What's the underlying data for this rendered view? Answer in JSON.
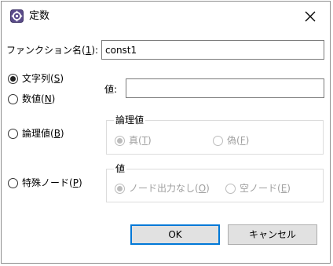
{
  "window": {
    "title": "定数",
    "icon": "constant-gear-icon",
    "close_icon": "close-icon"
  },
  "function_name": {
    "label_prefix": "ファンクション名(",
    "label_mnemonic": "1",
    "label_suffix": "):",
    "value": "const1"
  },
  "type_options": {
    "string": {
      "prefix": "文字列(",
      "mnemonic": "S",
      "suffix": ")",
      "selected": true
    },
    "number": {
      "prefix": "数値(",
      "mnemonic": "N",
      "suffix": ")",
      "selected": false
    },
    "boolean": {
      "prefix": "論理値(",
      "mnemonic": "B",
      "suffix": ")",
      "selected": false
    },
    "special_node": {
      "prefix": "特殊ノード(",
      "mnemonic": "P",
      "suffix": ")",
      "selected": false
    }
  },
  "value_field": {
    "label": "値:",
    "value": ""
  },
  "boolean_group": {
    "title": "論理値",
    "true_option": {
      "prefix": "真(",
      "mnemonic": "T",
      "suffix": ")",
      "selected": true
    },
    "false_option": {
      "prefix": "偽(",
      "mnemonic": "F",
      "suffix": ")",
      "selected": false
    }
  },
  "value_group": {
    "title": "値",
    "no_output_option": {
      "prefix": "ノード出力なし(",
      "mnemonic": "O",
      "suffix": ")",
      "selected": true
    },
    "empty_node_option": {
      "prefix": "空ノード(",
      "mnemonic": "E",
      "suffix": ")",
      "selected": false
    }
  },
  "buttons": {
    "ok": "OK",
    "cancel": "キャンセル"
  },
  "colors": {
    "default_button_border": "#0078d7",
    "button_face": "#e1e1e1",
    "disabled_text": "#a0a0a0"
  }
}
